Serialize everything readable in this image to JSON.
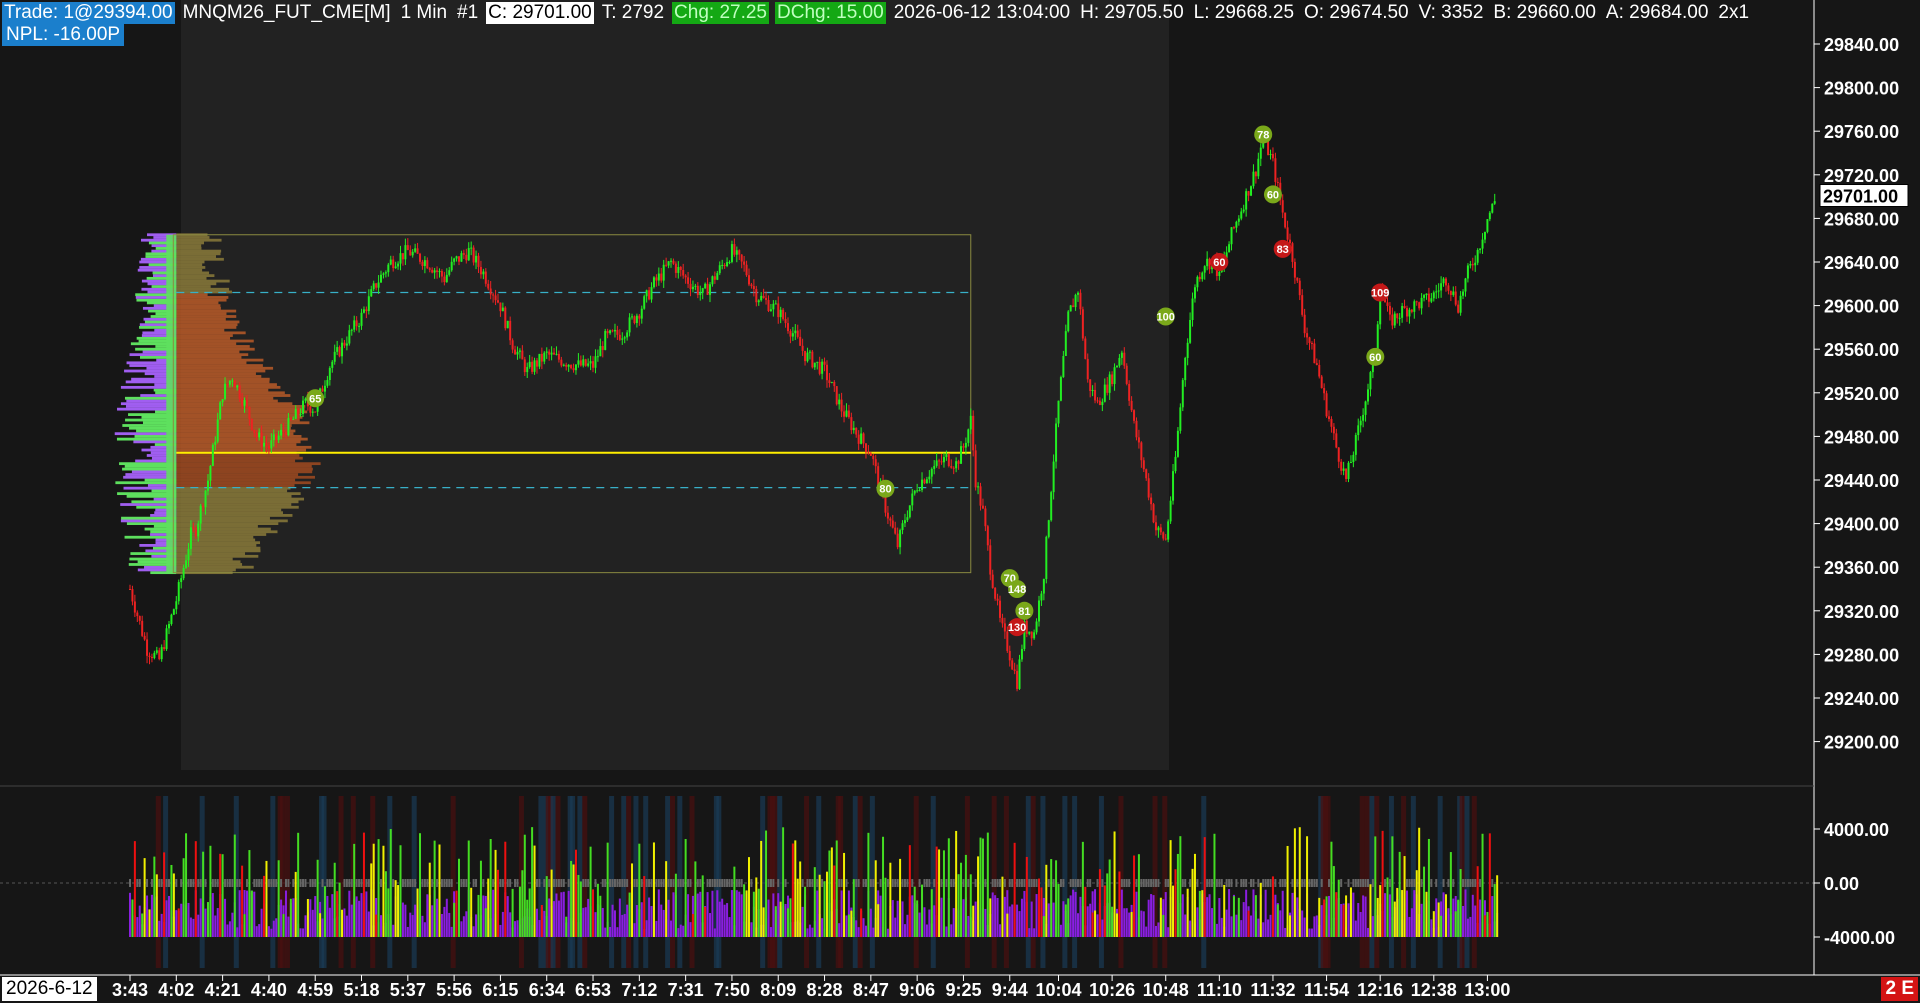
{
  "header": {
    "trade": "Trade: 1@29394.00",
    "symbol": "MNQM26_FUT_CME[M]",
    "interval": "1 Min",
    "chart_num": "#1",
    "close": "C: 29701.00",
    "ticks": "T: 2792",
    "chg": "Chg: 27.25",
    "dchg": "DChg: 15.00",
    "datetime": "2026-06-12 13:04:00",
    "high": "H: 29705.50",
    "low": "L: 29668.25",
    "open": "O: 29674.50",
    "volume": "V: 3352",
    "bid": "B: 29660.00",
    "ask": "A: 29684.00",
    "scale": "2x1"
  },
  "npl": "NPL: -16.00P",
  "date_label": "2026-6-12",
  "corner_label": "2 E",
  "colors": {
    "up": "#22ee22",
    "down": "#ee2222",
    "bg": "#161616",
    "session_bg": "#222222",
    "poc": "#ffee00",
    "va_line": "#38b0c8",
    "profile_up": "#5ee05e",
    "profile_dn": "#a05ef0",
    "osc_green": "#44dd22",
    "osc_yellow": "#f0f000",
    "osc_red": "#ee1010",
    "osc_purple": "#8a1ee0"
  },
  "chart_data": {
    "type": "candlestick",
    "price_axis": {
      "ticks": [
        "29840.00",
        "29800.00",
        "29760.00",
        "29720.00",
        "29680.00",
        "29640.00",
        "29600.00",
        "29560.00",
        "29520.00",
        "29480.00",
        "29440.00",
        "29400.00",
        "29360.00",
        "29320.00",
        "29280.00",
        "29240.00",
        "29200.00"
      ],
      "range": [
        29180,
        29860
      ],
      "current_price": "29701.00"
    },
    "oscillator_axis": {
      "ticks": [
        "4000.00",
        "0.00",
        "-4000.00"
      ],
      "range": [
        -6000,
        6000
      ]
    },
    "time_axis": [
      "3:43",
      "4:02",
      "4:21",
      "4:40",
      "4:59",
      "5:18",
      "5:37",
      "5:56",
      "6:15",
      "6:34",
      "6:53",
      "7:12",
      "7:31",
      "7:50",
      "8:09",
      "8:28",
      "8:47",
      "9:06",
      "9:25",
      "9:44",
      "10:04",
      "10:26",
      "10:48",
      "11:10",
      "11:32",
      "11:54",
      "12:16",
      "12:38",
      "13:00"
    ],
    "series": [
      {
        "name": "close",
        "points": [
          [
            "3:43",
            29340
          ],
          [
            "3:50",
            29285
          ],
          [
            "3:55",
            29275
          ],
          [
            "4:02",
            29330
          ],
          [
            "4:08",
            29390
          ],
          [
            "4:10",
            29395
          ],
          [
            "4:15",
            29440
          ],
          [
            "4:21",
            29520
          ],
          [
            "4:25",
            29535
          ],
          [
            "4:30",
            29510
          ],
          [
            "4:35",
            29480
          ],
          [
            "4:40",
            29470
          ],
          [
            "4:48",
            29490
          ],
          [
            "4:55",
            29510
          ],
          [
            "4:59",
            29505
          ],
          [
            "5:05",
            29545
          ],
          [
            "5:12",
            29570
          ],
          [
            "5:18",
            29590
          ],
          [
            "5:24",
            29620
          ],
          [
            "5:30",
            29640
          ],
          [
            "5:37",
            29650
          ],
          [
            "5:45",
            29640
          ],
          [
            "5:52",
            29625
          ],
          [
            "5:56",
            29640
          ],
          [
            "6:02",
            29650
          ],
          [
            "6:08",
            29630
          ],
          [
            "6:15",
            29600
          ],
          [
            "6:20",
            29565
          ],
          [
            "6:26",
            29540
          ],
          [
            "6:34",
            29555
          ],
          [
            "6:40",
            29550
          ],
          [
            "6:47",
            29545
          ],
          [
            "6:53",
            29545
          ],
          [
            "6:58",
            29570
          ],
          [
            "7:05",
            29575
          ],
          [
            "7:12",
            29595
          ],
          [
            "7:18",
            29620
          ],
          [
            "7:25",
            29640
          ],
          [
            "7:31",
            29625
          ],
          [
            "7:38",
            29610
          ],
          [
            "7:44",
            29630
          ],
          [
            "7:50",
            29650
          ],
          [
            "7:55",
            29635
          ],
          [
            "8:00",
            29610
          ],
          [
            "8:09",
            29595
          ],
          [
            "8:15",
            29575
          ],
          [
            "8:20",
            29555
          ],
          [
            "8:28",
            29540
          ],
          [
            "8:35",
            29505
          ],
          [
            "8:42",
            29480
          ],
          [
            "8:47",
            29465
          ],
          [
            "8:53",
            29415
          ],
          [
            "8:58",
            29380
          ],
          [
            "9:01",
            29405
          ],
          [
            "9:06",
            29435
          ],
          [
            "9:12",
            29450
          ],
          [
            "9:18",
            29460
          ],
          [
            "9:22",
            29455
          ],
          [
            "9:25",
            29470
          ],
          [
            "9:28",
            29495
          ],
          [
            "9:30",
            29440
          ],
          [
            "9:33",
            29410
          ],
          [
            "9:36",
            29360
          ],
          [
            "9:40",
            29310
          ],
          [
            "9:44",
            29280
          ],
          [
            "9:47",
            29255
          ],
          [
            "9:50",
            29305
          ],
          [
            "9:54",
            29300
          ],
          [
            "9:58",
            29355
          ],
          [
            "10:02",
            29460
          ],
          [
            "10:04",
            29510
          ],
          [
            "10:08",
            29590
          ],
          [
            "10:12",
            29615
          ],
          [
            "10:16",
            29530
          ],
          [
            "10:20",
            29510
          ],
          [
            "10:26",
            29535
          ],
          [
            "10:30",
            29560
          ],
          [
            "10:35",
            29490
          ],
          [
            "10:40",
            29440
          ],
          [
            "10:44",
            29395
          ],
          [
            "10:48",
            29385
          ],
          [
            "10:52",
            29460
          ],
          [
            "10:56",
            29555
          ],
          [
            "11:00",
            29620
          ],
          [
            "11:04",
            29640
          ],
          [
            "11:08",
            29640
          ],
          [
            "11:10",
            29625
          ],
          [
            "11:15",
            29665
          ],
          [
            "11:20",
            29695
          ],
          [
            "11:25",
            29725
          ],
          [
            "11:28",
            29755
          ],
          [
            "11:32",
            29730
          ],
          [
            "11:36",
            29685
          ],
          [
            "11:40",
            29645
          ],
          [
            "11:45",
            29580
          ],
          [
            "11:50",
            29545
          ],
          [
            "11:54",
            29505
          ],
          [
            "11:58",
            29470
          ],
          [
            "12:02",
            29440
          ],
          [
            "12:06",
            29475
          ],
          [
            "12:10",
            29515
          ],
          [
            "12:14",
            29555
          ],
          [
            "12:16",
            29620
          ],
          [
            "12:20",
            29585
          ],
          [
            "12:25",
            29595
          ],
          [
            "12:30",
            29600
          ],
          [
            "12:35",
            29605
          ],
          [
            "12:38",
            29610
          ],
          [
            "12:43",
            29625
          ],
          [
            "12:48",
            29600
          ],
          [
            "12:52",
            29630
          ],
          [
            "12:56",
            29650
          ],
          [
            "13:00",
            29680
          ],
          [
            "13:04",
            29701
          ]
        ]
      }
    ],
    "volume_profile": {
      "poc": 29465,
      "vah": 29612,
      "val": 29433,
      "range": [
        29355,
        29665
      ],
      "session": [
        "4:02",
        "9:28"
      ]
    },
    "markers": [
      {
        "time": "4:59",
        "price": 29515,
        "label": "65",
        "color": "green"
      },
      {
        "time": "8:53",
        "price": 29432,
        "label": "80",
        "color": "green"
      },
      {
        "time": "9:44",
        "price": 29350,
        "label": "70",
        "color": "green"
      },
      {
        "time": "9:47",
        "price": 29340,
        "label": "148",
        "color": "green"
      },
      {
        "time": "9:50",
        "price": 29320,
        "label": "81",
        "color": "green"
      },
      {
        "time": "9:47",
        "price": 29305,
        "label": "130",
        "color": "red"
      },
      {
        "time": "10:48",
        "price": 29590,
        "label": "100",
        "color": "green"
      },
      {
        "time": "11:10",
        "price": 29640,
        "label": "60",
        "color": "red"
      },
      {
        "time": "11:28",
        "price": 29757,
        "label": "78",
        "color": "green"
      },
      {
        "time": "11:32",
        "price": 29702,
        "label": "60",
        "color": "green"
      },
      {
        "time": "11:36",
        "price": 29652,
        "label": "83",
        "color": "red"
      },
      {
        "time": "12:14",
        "price": 29553,
        "label": "60",
        "color": "green"
      },
      {
        "time": "12:16",
        "price": 29612,
        "label": "109",
        "color": "red"
      }
    ]
  }
}
